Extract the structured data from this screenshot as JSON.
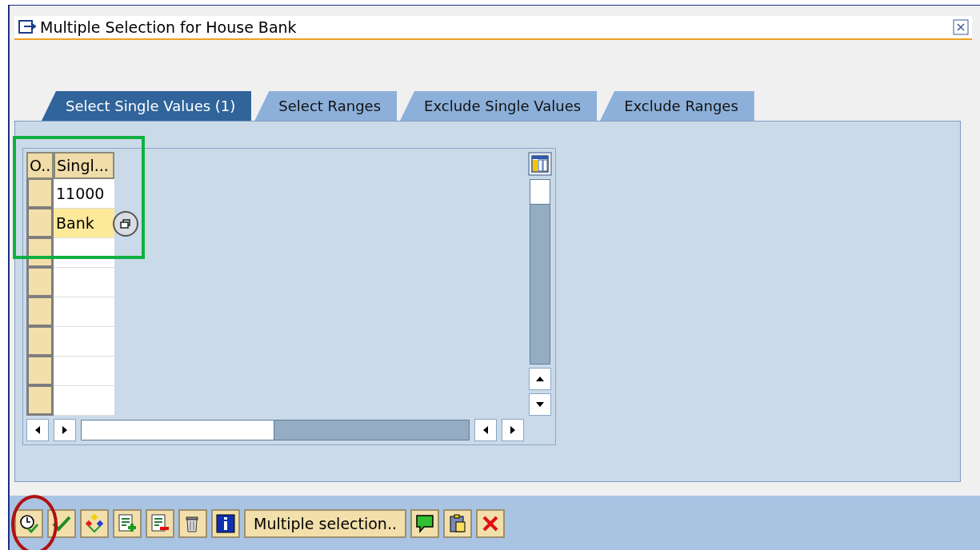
{
  "window": {
    "title": "Multiple Selection for House Bank"
  },
  "tabs": [
    {
      "label": "Select Single Values (1)",
      "selected": true
    },
    {
      "label": "Select Ranges",
      "selected": false
    },
    {
      "label": "Exclude Single Values",
      "selected": false
    },
    {
      "label": "Exclude Ranges",
      "selected": false
    }
  ],
  "table": {
    "columns": [
      "O..",
      "Singl..."
    ],
    "rows": [
      {
        "value": "11000",
        "focused": false
      },
      {
        "value": "Bank",
        "focused": true
      },
      {
        "focused": false
      },
      {
        "focused": false
      },
      {
        "focused": false
      },
      {
        "focused": false
      },
      {
        "focused": false
      },
      {
        "focused": false
      }
    ]
  },
  "toolbar": [
    {
      "kind": "icon"
    },
    {
      "kind": "icon"
    },
    {
      "kind": "icon"
    },
    {
      "kind": "icon"
    },
    {
      "kind": "icon"
    },
    {
      "kind": "icon"
    },
    {
      "kind": "icon"
    },
    {
      "kind": "text",
      "label": "Multiple selection.."
    },
    {
      "kind": "icon"
    },
    {
      "kind": "icon"
    },
    {
      "kind": "icon"
    }
  ]
}
